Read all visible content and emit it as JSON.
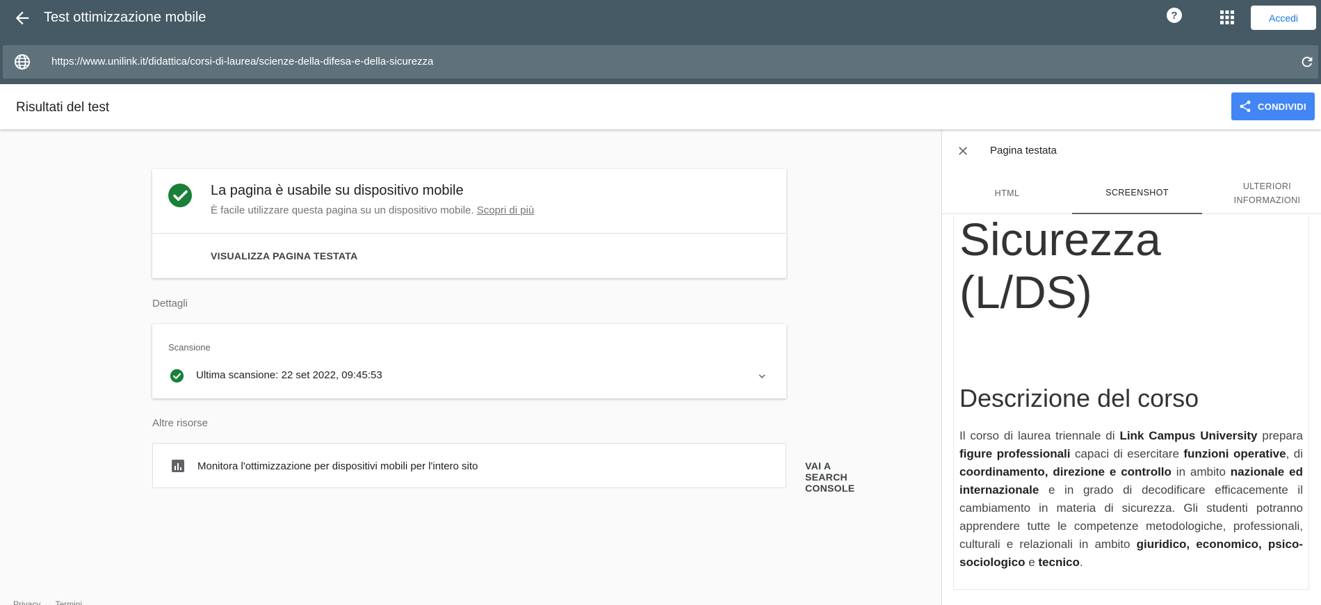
{
  "appbar": {
    "title": "Test ottimizzazione mobile",
    "signin_label": "Accedi",
    "url": "https://www.unilink.it/didattica/corsi-di-laurea/scienze-della-difesa-e-della-sicurezza"
  },
  "results": {
    "title": "Risultati del test",
    "share_label": "CONDIVIDI"
  },
  "main_card": {
    "heading": "La pagina è usabile su dispositivo mobile",
    "subtitle": "È facile utilizzare questa pagina su un dispositivo mobile.",
    "learn_more": "Scopri di più",
    "view_label": "VISUALIZZA PAGINA TESTATA"
  },
  "details": {
    "label": "Dettagli",
    "scan_label": "Scansione",
    "scan_text": "Ultima scansione: 22 set 2022, 09:45:53"
  },
  "resources": {
    "label": "Altre risorse",
    "text": "Monitora l'ottimizzazione per dispositivi mobili per l'intero sito",
    "link": "VAI A SEARCH CONSOLE"
  },
  "footer": {
    "privacy": "Privacy",
    "terms": "Termini"
  },
  "panel": {
    "title": "Pagina testata",
    "tabs": [
      {
        "label": "HTML"
      },
      {
        "label": "SCREENSHOT"
      },
      {
        "label": "ULTERIORI INFORMAZIONI"
      }
    ],
    "shot_big_line1": "Sicurezza",
    "shot_big_line2": "(L/DS)",
    "shot_heading": "Descrizione del corso"
  },
  "colors": {
    "appbar": "#455a64",
    "urlbar": "#5f727c",
    "accent": "#4285f4",
    "success": "#188038"
  }
}
